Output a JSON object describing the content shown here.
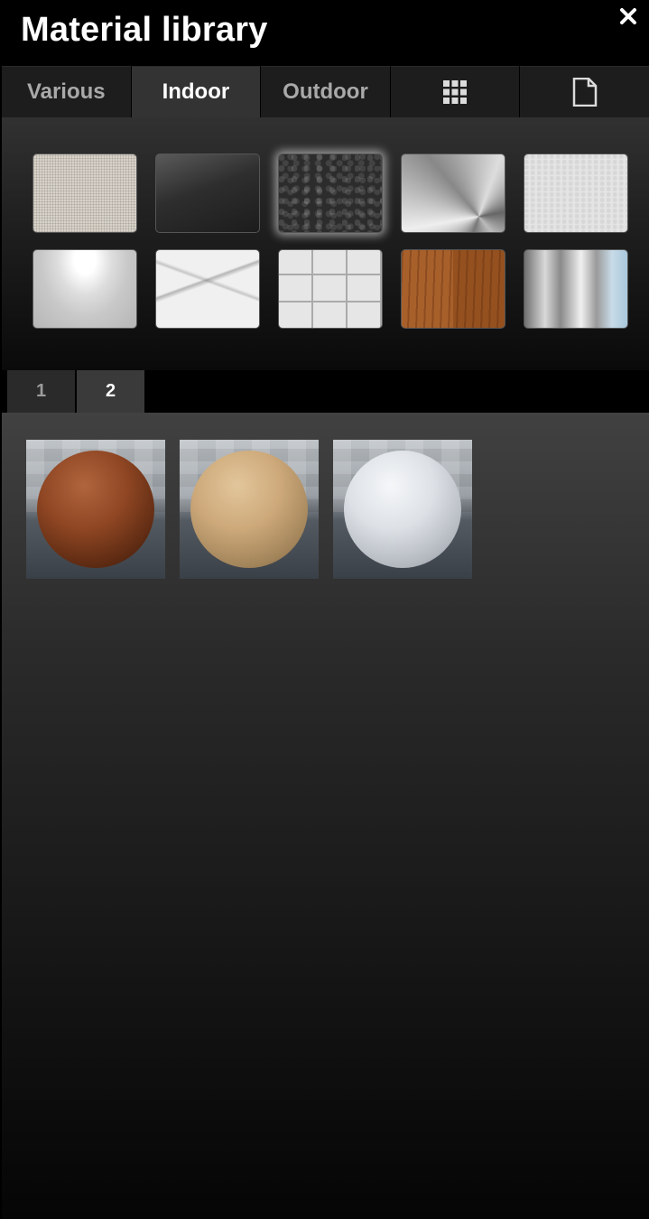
{
  "header": {
    "title": "Material library",
    "close_icon": "close-icon"
  },
  "tabs": [
    {
      "label": "Various",
      "active": false
    },
    {
      "label": "Indoor",
      "active": true
    },
    {
      "label": "Outdoor",
      "active": false
    },
    {
      "icon": "grid-icon",
      "active": false
    },
    {
      "icon": "document-icon",
      "active": false
    }
  ],
  "swatches": [
    {
      "name": "linen",
      "selected": false
    },
    {
      "name": "dark-glass",
      "selected": false
    },
    {
      "name": "black-leather",
      "selected": true
    },
    {
      "name": "brushed-steel",
      "selected": false
    },
    {
      "name": "white-stucco",
      "selected": false
    },
    {
      "name": "glossy-white",
      "selected": false
    },
    {
      "name": "white-marble",
      "selected": false
    },
    {
      "name": "white-tiles",
      "selected": false
    },
    {
      "name": "wood-parquet",
      "selected": false
    },
    {
      "name": "curtain",
      "selected": false
    }
  ],
  "pages": [
    {
      "label": "1",
      "active": false
    },
    {
      "label": "2",
      "active": true
    }
  ],
  "thumbnails": [
    {
      "name": "terracotta-sphere",
      "color": "#8f4623"
    },
    {
      "name": "tan-sphere",
      "color": "#cda97a"
    },
    {
      "name": "white-sphere",
      "color": "#dde1e6"
    }
  ]
}
